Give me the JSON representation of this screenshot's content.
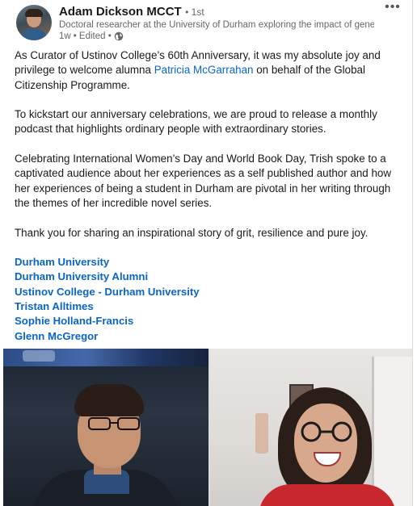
{
  "post": {
    "author": {
      "name": "Adam Dickson MCCT",
      "degree": "• 1st",
      "headline": "Doctoral researcher at the University of Durham exploring the impact of gene...",
      "time": "1w",
      "edited": "• Edited •",
      "visibility_icon": "globe-icon"
    },
    "more_label": "•••",
    "paragraphs": {
      "p1_before": "As Curator of Ustinov College’s 60th Anniversary, it was my absolute joy and privilege to welcome alumna ",
      "p1_mention": "Patricia McGarrahan",
      "p1_after": " on behalf of the Global Citizenship Programme.",
      "p2": "To kickstart our anniversary celebrations, we are proud to release a monthly podcast that highlights ordinary people with extraordinary stories.",
      "p3": "Celebrating International Women’s Day and World Book Day, Trish spoke to a captivated audience about her experiences as a self published author and how her experiences of being a student in Durham are pivotal in her writing through the themes of her incredible novel series.",
      "p4": "Thank you for sharing an inspirational story of grit, resilience and pure joy."
    },
    "tags": [
      "Durham University",
      "Durham University Alumni",
      "Ustinov College - Durham University",
      "Tristan Alltimes",
      "Sophie Holland-Francis",
      "Glenn McGregor"
    ],
    "colors": {
      "link": "#0a66c2",
      "text": "#191919",
      "muted": "#666666"
    }
  }
}
